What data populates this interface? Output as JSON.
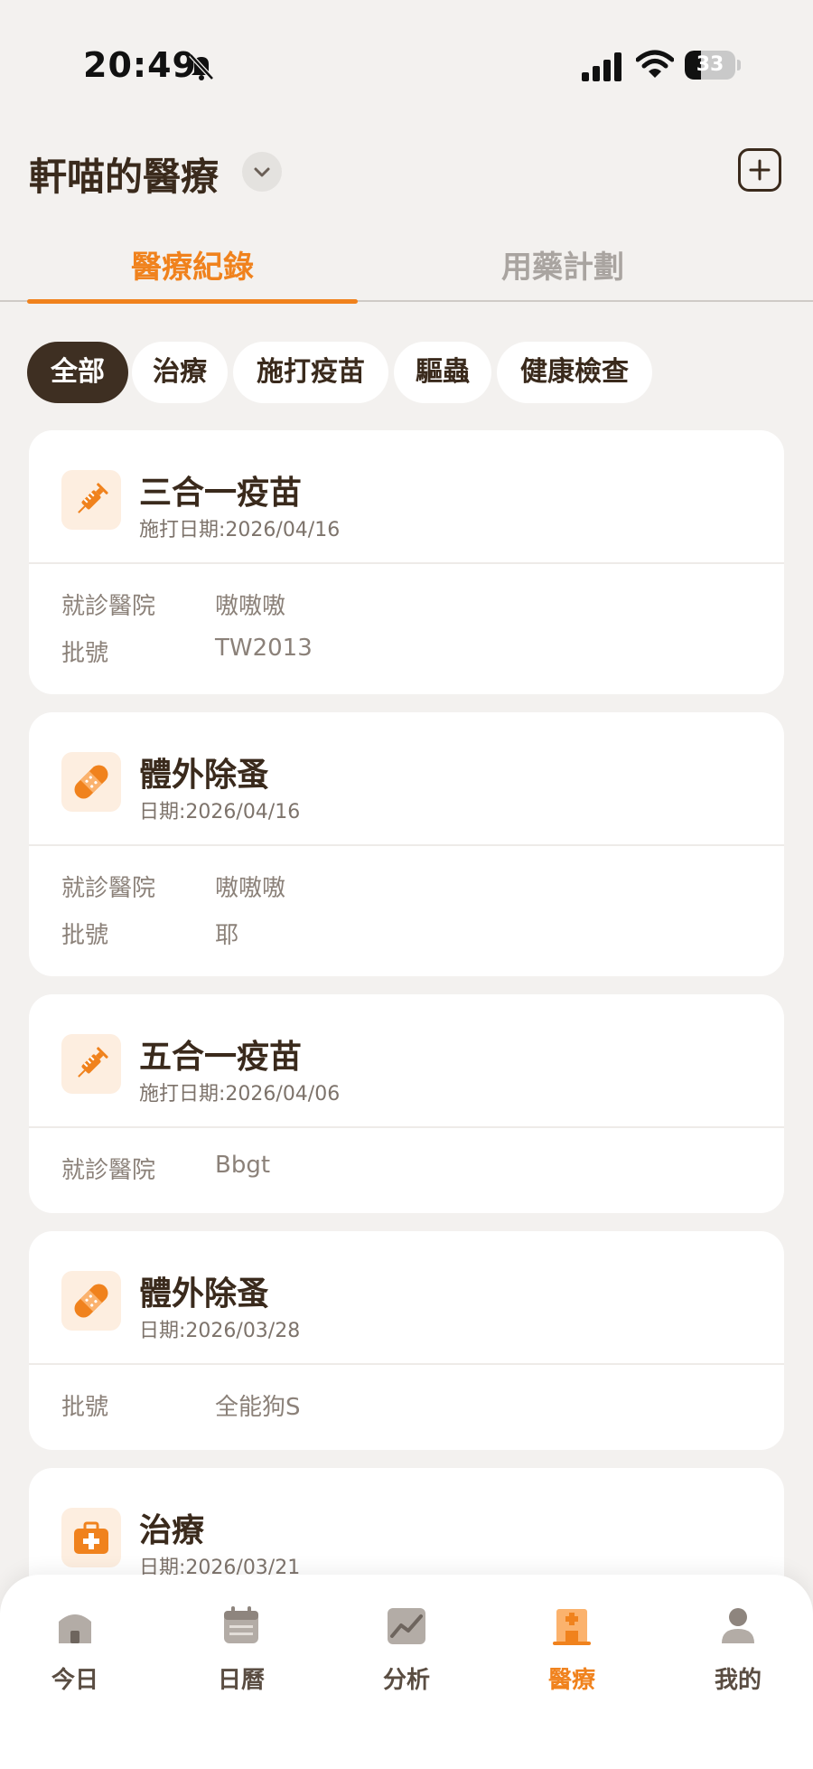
{
  "status_bar": {
    "time": "20:49",
    "battery": "33",
    "battery_level": 0.33
  },
  "header": {
    "title": "軒喵的醫療"
  },
  "tabs": [
    {
      "label": "醫療紀錄",
      "active": true
    },
    {
      "label": "用藥計劃",
      "active": false
    }
  ],
  "filters": [
    {
      "label": "全部",
      "active": true
    },
    {
      "label": "治療",
      "active": false
    },
    {
      "label": "施打疫苗",
      "active": false
    },
    {
      "label": "驅蟲",
      "active": false
    },
    {
      "label": "健康檢查",
      "active": false
    }
  ],
  "records": [
    {
      "icon": "syringe-icon",
      "title": "三合一疫苗",
      "date": "施打日期:2026/04/16",
      "rows": [
        {
          "label": "就診醫院",
          "value": "嗷嗷嗷"
        },
        {
          "label": "批號",
          "value": "TW2013"
        }
      ]
    },
    {
      "icon": "bandage-icon",
      "title": "體外除蚤",
      "date": "日期:2026/04/16",
      "rows": [
        {
          "label": "就診醫院",
          "value": "嗷嗷嗷"
        },
        {
          "label": "批號",
          "value": "耶"
        }
      ]
    },
    {
      "icon": "syringe-icon",
      "title": "五合一疫苗",
      "date": "施打日期:2026/04/06",
      "rows": [
        {
          "label": "就診醫院",
          "value": "Bbgt"
        }
      ]
    },
    {
      "icon": "bandage-icon",
      "title": "體外除蚤",
      "date": "日期:2026/03/28",
      "rows": [
        {
          "label": "批號",
          "value": "全能狗S"
        }
      ]
    },
    {
      "icon": "medkit-icon",
      "title": "治療",
      "date": "日期:2026/03/21",
      "rows": []
    }
  ],
  "bottom_nav": [
    {
      "label": "今日",
      "icon": "home-icon",
      "active": false
    },
    {
      "label": "日曆",
      "icon": "calendar-icon",
      "active": false
    },
    {
      "label": "分析",
      "icon": "chart-icon",
      "active": false
    },
    {
      "label": "醫療",
      "icon": "hospital-icon",
      "active": true
    },
    {
      "label": "我的",
      "icon": "profile-icon",
      "active": false
    }
  ],
  "colors": {
    "accent": "#f0821d",
    "dark_brown": "#3e2f22",
    "background": "#f3f1ef",
    "icon_tint": "#fdeee0"
  }
}
